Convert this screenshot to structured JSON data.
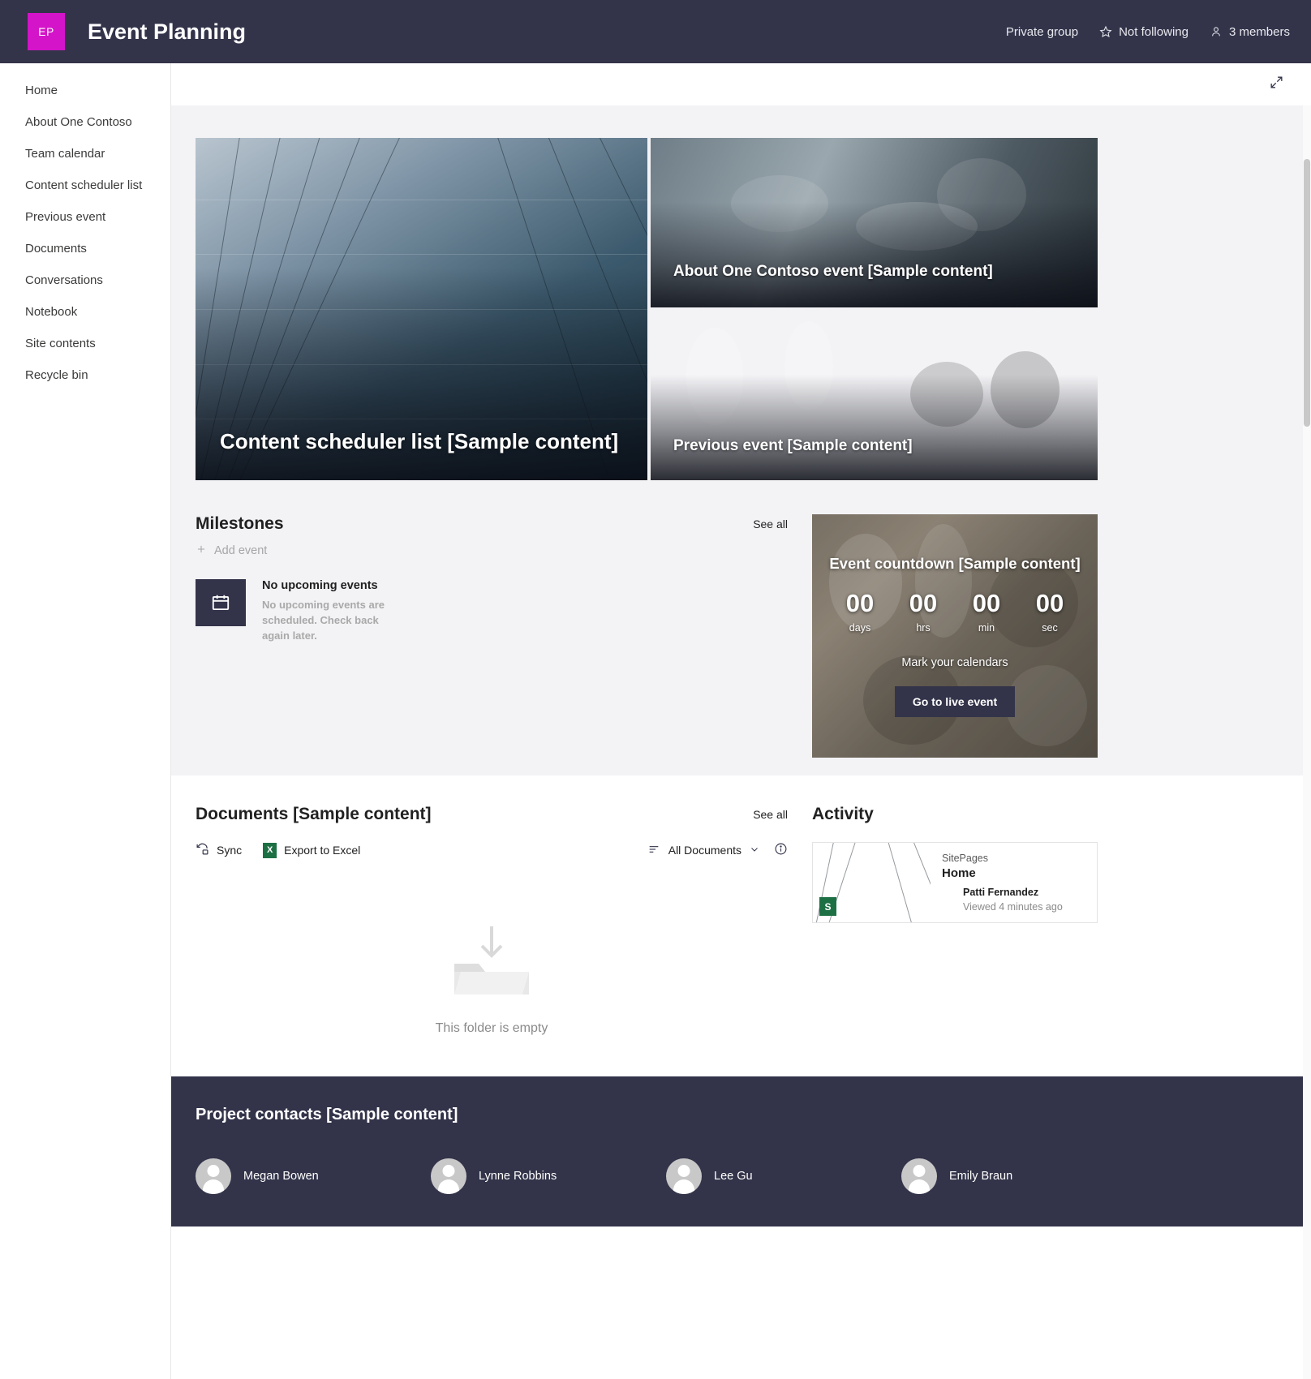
{
  "header": {
    "logo_initials": "EP",
    "title": "Event Planning",
    "privacy": "Private group",
    "following": "Not following",
    "members": "3 members"
  },
  "sidebar": {
    "items": [
      {
        "label": "Home"
      },
      {
        "label": "About One Contoso"
      },
      {
        "label": "Team calendar"
      },
      {
        "label": "Content scheduler list"
      },
      {
        "label": "Previous event"
      },
      {
        "label": "Documents"
      },
      {
        "label": "Conversations"
      },
      {
        "label": "Notebook"
      },
      {
        "label": "Site contents"
      },
      {
        "label": "Recycle bin"
      }
    ]
  },
  "hero": {
    "main": {
      "caption": "Content scheduler list [Sample content]"
    },
    "top_right": {
      "caption": "About One Contoso event [Sample content]"
    },
    "bottom_right": {
      "caption": "Previous event [Sample content]"
    }
  },
  "milestones": {
    "title": "Milestones",
    "see_all": "See all",
    "add_event": "Add event",
    "empty_title": "No upcoming events",
    "empty_sub": "No upcoming events are scheduled. Check back again later."
  },
  "countdown": {
    "title": "Event countdown [Sample content]",
    "units": [
      {
        "value": "00",
        "label": "days"
      },
      {
        "value": "00",
        "label": "hrs"
      },
      {
        "value": "00",
        "label": "min"
      },
      {
        "value": "00",
        "label": "sec"
      }
    ],
    "mark_text": "Mark your calendars",
    "button": "Go to live event"
  },
  "documents": {
    "title": "Documents [Sample content]",
    "see_all": "See all",
    "sync": "Sync",
    "export": "Export to Excel",
    "excel_letter": "X",
    "view": "All Documents",
    "empty": "This folder is empty"
  },
  "activity": {
    "title": "Activity",
    "card": {
      "library": "SitePages",
      "page": "Home",
      "user": "Patti Fernandez",
      "time": "Viewed 4 minutes ago",
      "badge_letter": "S"
    }
  },
  "contacts": {
    "title": "Project contacts [Sample content]",
    "people": [
      {
        "name": "Megan Bowen"
      },
      {
        "name": "Lynne Robbins"
      },
      {
        "name": "Lee Gu"
      },
      {
        "name": "Emily Braun"
      }
    ]
  },
  "colors": {
    "header_bg": "#33344a",
    "logo_bg": "#d414c8",
    "accent": "#33344a"
  }
}
